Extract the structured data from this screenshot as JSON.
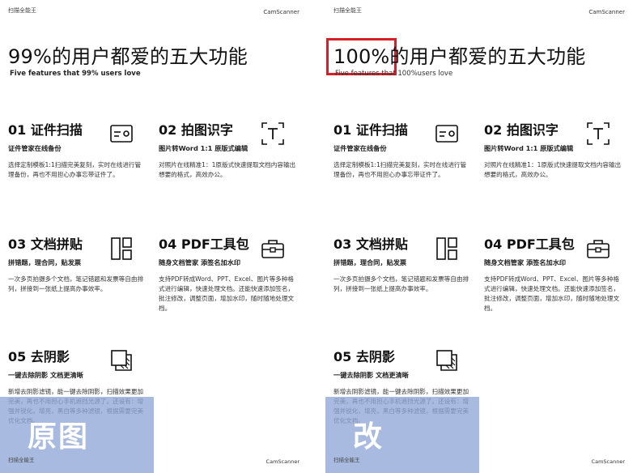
{
  "pages": {
    "left": {
      "app_name": "扫描全能王",
      "brand": "CamScanner",
      "headline": {
        "percent": "99%",
        "rest": "的用户都爱的五大功能"
      },
      "subhead": "Five features that 99% users love",
      "overlay_label": "原图"
    },
    "right": {
      "app_name": "扫描全能王",
      "brand": "CamScanner",
      "headline": {
        "percent": "100%",
        "rest": "的用户都爱的五大功能"
      },
      "subhead": "Five features that 100%users love",
      "overlay_label": "改"
    }
  },
  "features": [
    {
      "title": "01 证件扫描",
      "subtitle": "证件管家在线备份",
      "desc": "选择定制模板1:1扫描完美复刻，实时在线进行管理备份，再也不用担心办事忘带证件了。",
      "icon": "id-card-icon"
    },
    {
      "title": "02 拍图识字",
      "subtitle": "图片转Word 1:1 原版式编辑",
      "desc": "对照片在线精准1：1原版式快速提取文档内容输出想要的格式，高效办公。",
      "icon": "text-recognition-icon"
    },
    {
      "title": "03 文档拼贴",
      "subtitle": "拼错题，理合同，贴发票",
      "desc": "一次多页拍摄多个文档，笔记错题和发票等自由排列，拼接到一张纸上提高办事效率。",
      "icon": "collage-icon"
    },
    {
      "title": "04 PDF工具包",
      "subtitle": "随身文档管家 添签名加水印",
      "desc": "支持PDF转成Word、PPT、Excel、图片等多种格式进行编辑，快速处理文档。还能快速添加签名，批注修改，调整页面，增加水印，随时随地处理文档。",
      "icon": "toolbox-icon"
    },
    {
      "title": "05 去阴影",
      "subtitle": "一键去除阴影 文档更清晰",
      "desc": "新增去阴影滤镜，能一键去除阴影，扫描效果更加完美，再也不用担心手机遮挡光源了。还设有：增强并锐化，增亮，黑白等多种滤镜，根据需要完美优化文档。",
      "icon": "shadow-removal-icon"
    }
  ],
  "colors": {
    "highlight_box": "#d61f26",
    "overlay": "#90a6d6"
  }
}
